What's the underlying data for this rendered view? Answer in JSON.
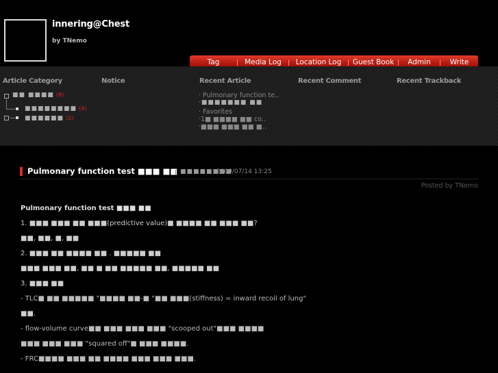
{
  "header": {
    "title": "innering@Chest",
    "author": "by TNemo"
  },
  "menu": [
    "Tag",
    "Media Log",
    "Location Log",
    "Guest Book",
    "Admin",
    "Write"
  ],
  "sidebar": {
    "category_title": "Article Category",
    "notice_title": "Notice",
    "recent_article_title": "Recent Article",
    "recent_comment_title": "Recent Comment",
    "recent_trackback_title": "Recent Trackback",
    "categories": [
      {
        "label": "■■ ■■■■",
        "count": "(8)"
      },
      {
        "label": "■■■■■■■■",
        "count": "(4)"
      },
      {
        "label": "■■■■■■",
        "count": "(2)"
      }
    ],
    "recent_articles": [
      "· Pulmonary function te..",
      "·■■■■■■■ ■■",
      "· Favorites",
      "·1■ ■■■■ ■■ co..",
      "·■■■ ■■■ ■■ ■.."
    ]
  },
  "post": {
    "title": "Pulmonary function test ■■■ ■■",
    "category": "■■■■■■■■",
    "date": "2009/07/14 13:25",
    "posted_by": "Posted by TNemo",
    "lines": [
      "Pulmonary function test ■■■ ■■",
      "1. ■■■ ■■■ ■■ ■■■(predictive value)■ ■■■■ ■■ ■■■ ■■?",
      "■■, ■■, ■, ■■",
      "2. ■■■ ■■ ■■■■ ■■ . ■■■■■ ■■",
      "■■■ ■■■ ■■, ■■ ■ ■■ ■■■■■ ■■, ■■■■■ ■■",
      "3. ■■■ ■■",
      "- TLC■ ■■ ■■■■■ \"■■■■ ■■-■ \"■■ ■■■(stiffness) = inward recoil of lung\"",
      "■■.",
      "- flow-volume curve■■ ■■■ ■■■ ■■■ \"scooped out\"■■■ ■■■■",
      "■■■ ■■■ ■■■ \"squared off\"■ ■■■ ■■■■.",
      "- FRC■■■■ ■■■ ■■ ■■■■ ■■■ ■■■ ■■■."
    ]
  }
}
